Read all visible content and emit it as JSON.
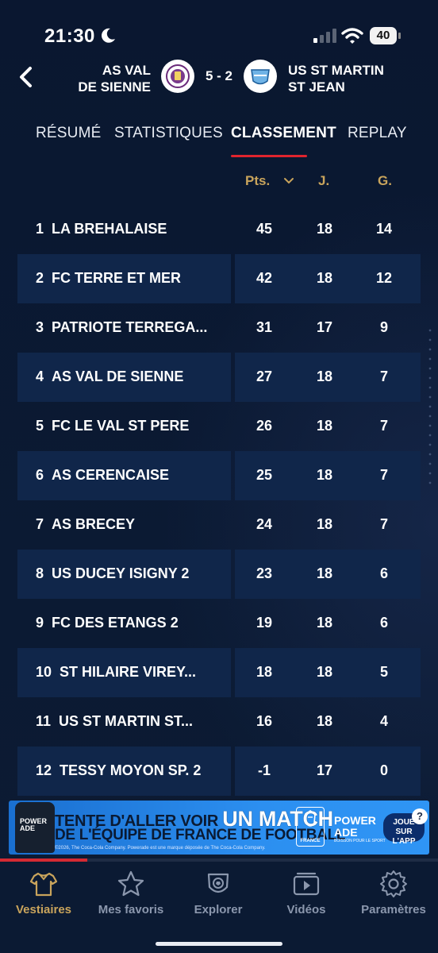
{
  "status_bar": {
    "time": "21:30",
    "battery": "40"
  },
  "match": {
    "home_team_line1": "AS VAL",
    "home_team_line2": "DE SIENNE",
    "score": "5 - 2",
    "away_team_line1": "US ST MARTIN",
    "away_team_line2": "ST JEAN"
  },
  "tabs": [
    {
      "label": "RÉSUMÉ",
      "active": false
    },
    {
      "label": "STATISTIQUES",
      "active": false
    },
    {
      "label": "CLASSEMENT",
      "active": true
    },
    {
      "label": "REPLAY",
      "active": false
    }
  ],
  "table": {
    "columns": [
      "Pts.",
      "J.",
      "G."
    ],
    "sort_column": "Pts.",
    "rows": [
      {
        "rank": "1",
        "team": "LA BREHALAISE",
        "pts": "45",
        "j": "18",
        "g": "14"
      },
      {
        "rank": "2",
        "team": "FC TERRE ET MER",
        "pts": "42",
        "j": "18",
        "g": "12"
      },
      {
        "rank": "3",
        "team": "PATRIOTE TERREGA...",
        "pts": "31",
        "j": "17",
        "g": "9"
      },
      {
        "rank": "4",
        "team": "AS VAL DE SIENNE",
        "pts": "27",
        "j": "18",
        "g": "7"
      },
      {
        "rank": "5",
        "team": "FC LE VAL ST PERE",
        "pts": "26",
        "j": "18",
        "g": "7"
      },
      {
        "rank": "6",
        "team": "AS CERENCAISE",
        "pts": "25",
        "j": "18",
        "g": "7"
      },
      {
        "rank": "7",
        "team": "AS BRECEY",
        "pts": "24",
        "j": "18",
        "g": "7"
      },
      {
        "rank": "8",
        "team": "US DUCEY ISIGNY 2",
        "pts": "23",
        "j": "18",
        "g": "6"
      },
      {
        "rank": "9",
        "team": "FC DES ETANGS 2",
        "pts": "19",
        "j": "18",
        "g": "6"
      },
      {
        "rank": "10",
        "team": "ST HILAIRE VIREY...",
        "pts": "18",
        "j": "18",
        "g": "5"
      },
      {
        "rank": "11",
        "team": "US ST MARTIN ST...",
        "pts": "16",
        "j": "18",
        "g": "4"
      },
      {
        "rank": "12",
        "team": "TESSY MOYON SP. 2",
        "pts": "-1",
        "j": "17",
        "g": "0"
      }
    ]
  },
  "ad": {
    "line1_prefix": "TENTE D'ALLER VOIR",
    "line1_highlight": "UN MATCH",
    "line2": "DE L'ÉQUIPE DE FRANCE DE FOOTBALL",
    "fine_print": "©2026, The Coca-Cola Company. Powerade est une marque déposée de The Coca-Cola Company.",
    "bottle_label": "POWER ADE",
    "badge_label": "FRANCE",
    "brand_line1": "POWER",
    "brand_line2": "ADE",
    "brand_sub": "BOISSON POUR LE SPORT",
    "cta_line1": "JOUE",
    "cta_line2": "SUR L'APP",
    "help": "?"
  },
  "progress": 0.2,
  "bottom_nav": [
    {
      "label": "Vestiaires",
      "icon": "jersey-icon",
      "active": true
    },
    {
      "label": "Mes favoris",
      "icon": "star-icon",
      "active": false
    },
    {
      "label": "Explorer",
      "icon": "shield-ball-icon",
      "active": false
    },
    {
      "label": "Vidéos",
      "icon": "video-icon",
      "active": false
    },
    {
      "label": "Paramètres",
      "icon": "gear-icon",
      "active": false
    }
  ],
  "colors": {
    "accent_red": "#e0242e",
    "gold": "#c9a45c",
    "background": "#0b1830",
    "row_stripe": "#10264a"
  }
}
